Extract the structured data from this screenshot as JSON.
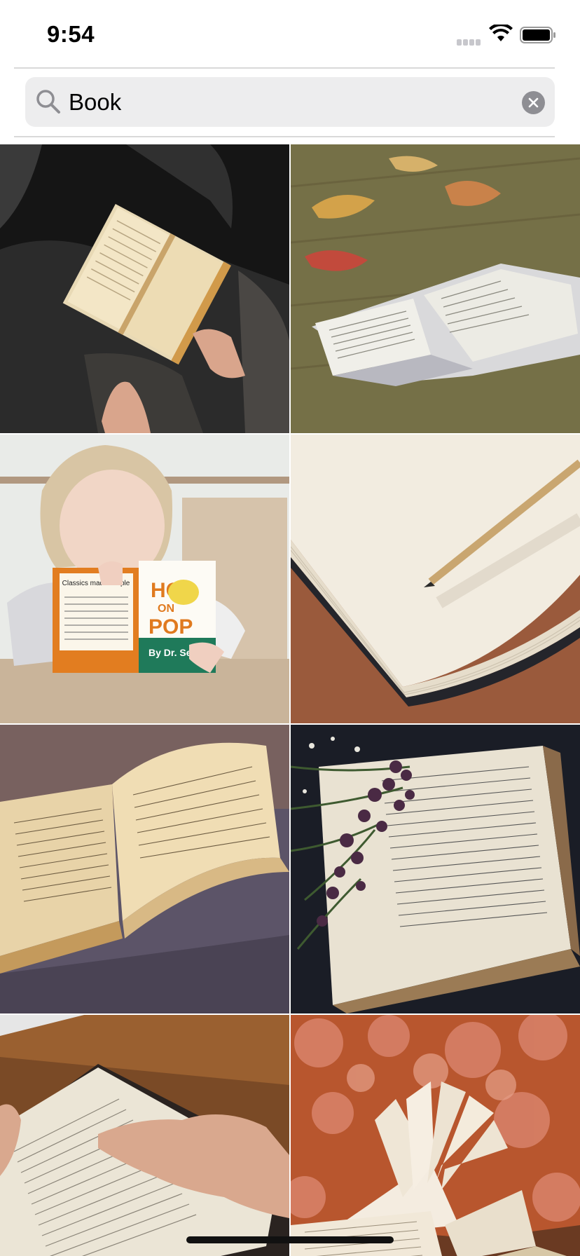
{
  "status_bar": {
    "time": "9:54"
  },
  "search": {
    "query": "Book",
    "icon": "magnifying-glass",
    "clear_icon": "x-circle"
  },
  "photos": [
    {
      "id": 1,
      "subject": "hands-holding-open-paperback"
    },
    {
      "id": 2,
      "subject": "open-bible-on-wooden-table-with-leaves"
    },
    {
      "id": 3,
      "subject": "child-reading-hop-on-pop"
    },
    {
      "id": 4,
      "subject": "blank-notebook-with-pencil"
    },
    {
      "id": 5,
      "subject": "old-handwritten-book-open"
    },
    {
      "id": 6,
      "subject": "open-book-with-purple-flowers"
    },
    {
      "id": 7,
      "subject": "hand-on-open-book-pages"
    },
    {
      "id": 8,
      "subject": "book-pages-fanned-autumn-leaves"
    }
  ],
  "photo_text": {
    "cover_blurb": "Classics made simple",
    "title_hop": "HOP",
    "title_on": "ON",
    "title_pop": "POP",
    "author": "By Dr. Seuss"
  },
  "colors": {
    "search_bg": "#ededee",
    "clear_bg": "#8e8e93",
    "divider": "#d9d9d9"
  }
}
